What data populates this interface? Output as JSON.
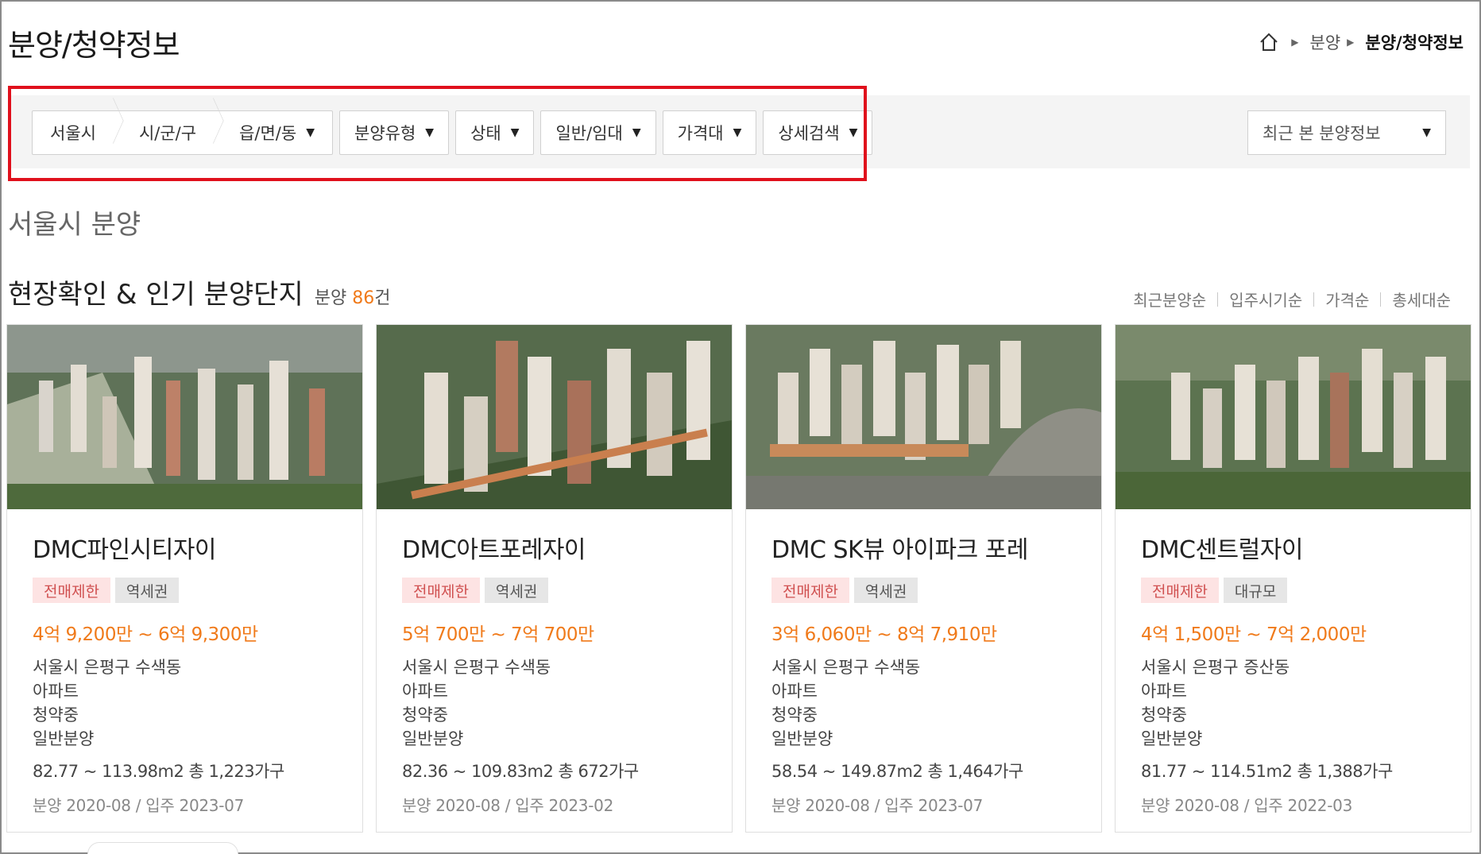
{
  "header": {
    "title": "분양/청약정보",
    "breadcrumb": [
      "분양",
      "분양/청약정보"
    ]
  },
  "filters": {
    "location": [
      "서울시",
      "시/군/구",
      "읍/면/동"
    ],
    "dropdowns": [
      "분양유형",
      "상태",
      "일반/임대",
      "가격대",
      "상세검색"
    ],
    "recent_select": "최근 본 분양정보"
  },
  "region_title": "서울시 분양",
  "section": {
    "title": "현장확인 & 인기 분양단지",
    "count_prefix": "분양 ",
    "count": "86",
    "count_suffix": "건"
  },
  "sort_options": [
    "최근분양순",
    "입주시기순",
    "가격순",
    "총세대순"
  ],
  "colors": {
    "accent": "#f07a1a",
    "highlight_border": "#e0101c",
    "tag_red_bg": "#fde3e3",
    "tag_gray_bg": "#e6e6e6"
  },
  "listings": [
    {
      "name": "DMC파인시티자이",
      "tags": [
        {
          "label": "전매제한",
          "style": "red"
        },
        {
          "label": "역세권",
          "style": "gray"
        }
      ],
      "price": "4억 9,200만 ~ 6억 9,300만",
      "address": "서울시 은평구 수색동",
      "type": "아파트",
      "status": "청약중",
      "supply": "일반분양",
      "size": "82.77 ~ 113.98m2  총 1,223가구",
      "dates": "분양 2020-08 / 입주 2023-07"
    },
    {
      "name": "DMC아트포레자이",
      "tags": [
        {
          "label": "전매제한",
          "style": "red"
        },
        {
          "label": "역세권",
          "style": "gray"
        }
      ],
      "price": "5억 700만 ~ 7억 700만",
      "address": "서울시 은평구 수색동",
      "type": "아파트",
      "status": "청약중",
      "supply": "일반분양",
      "size": "82.36 ~ 109.83m2  총 672가구",
      "dates": "분양 2020-08 / 입주 2023-02"
    },
    {
      "name": "DMC SK뷰 아이파크 포레",
      "tags": [
        {
          "label": "전매제한",
          "style": "red"
        },
        {
          "label": "역세권",
          "style": "gray"
        }
      ],
      "price": "3억 6,060만 ~ 8억 7,910만",
      "address": "서울시 은평구 수색동",
      "type": "아파트",
      "status": "청약중",
      "supply": "일반분양",
      "size": "58.54 ~ 149.87m2  총 1,464가구",
      "dates": "분양 2020-08 / 입주 2023-07"
    },
    {
      "name": "DMC센트럴자이",
      "tags": [
        {
          "label": "전매제한",
          "style": "red"
        },
        {
          "label": "대규모",
          "style": "gray"
        }
      ],
      "price": "4억 1,500만 ~ 7억 2,000만",
      "address": "서울시 은평구 증산동",
      "type": "아파트",
      "status": "청약중",
      "supply": "일반분양",
      "size": "81.77 ~ 114.51m2  총 1,388가구",
      "dates": "분양 2020-08 / 입주 2022-03"
    }
  ]
}
